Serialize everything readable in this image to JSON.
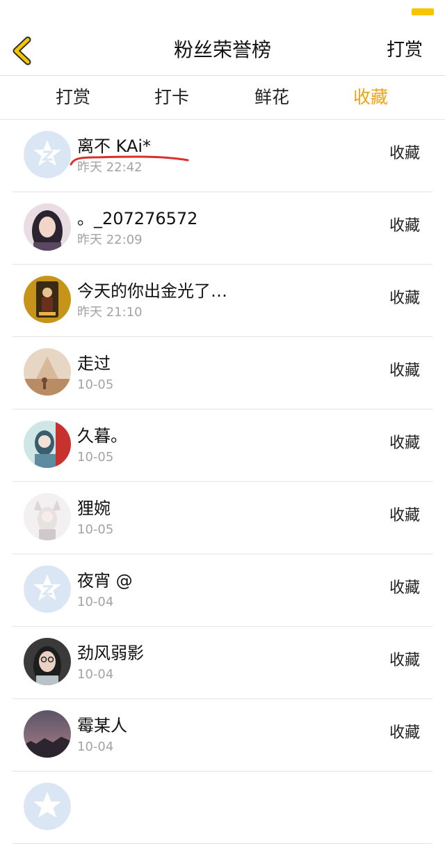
{
  "header": {
    "title": "粉丝荣誉榜",
    "right_label": "打赏"
  },
  "tabs": [
    {
      "label": "打赏",
      "active": false
    },
    {
      "label": "打卡",
      "active": false
    },
    {
      "label": "鲜花",
      "active": false
    },
    {
      "label": "收藏",
      "active": true
    }
  ],
  "colors": {
    "accent": "#f0a312",
    "battery": "#f5c500",
    "default_avatar": "#dbe6f5",
    "annotation": "#d9302b"
  },
  "fans": [
    {
      "name": "离不 KAi*",
      "time": "昨天 22:42",
      "action": "收藏",
      "avatar": "default-avatar-icon"
    },
    {
      "name": "。_207276572",
      "time": "昨天 22:09",
      "action": "收藏",
      "avatar": "girl-portrait-photo"
    },
    {
      "name": "今天的你出金光了…",
      "time": "昨天 21:10",
      "action": "收藏",
      "avatar": "game-card-photo"
    },
    {
      "name": "走过",
      "time": "10-05",
      "action": "收藏",
      "avatar": "illustration-photo"
    },
    {
      "name": "久暮。",
      "time": "10-05",
      "action": "收藏",
      "avatar": "anime-girl-photo"
    },
    {
      "name": "狸婉",
      "time": "10-05",
      "action": "收藏",
      "avatar": "fox-girl-photo"
    },
    {
      "name": "夜宵 @",
      "time": "10-04",
      "action": "收藏",
      "avatar": "default-avatar-icon"
    },
    {
      "name": "劲风弱影",
      "time": "10-04",
      "action": "收藏",
      "avatar": "glasses-girl-photo"
    },
    {
      "name": "霉某人",
      "time": "10-04",
      "action": "收藏",
      "avatar": "dusk-sky-photo"
    },
    {
      "name": "",
      "time": "",
      "action": "",
      "avatar": "default-avatar-icon"
    }
  ]
}
